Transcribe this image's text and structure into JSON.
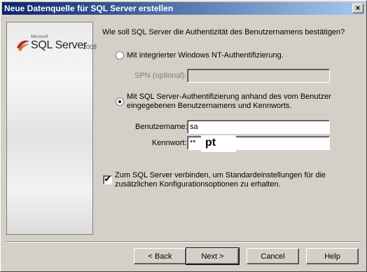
{
  "window": {
    "title": "Neue Datenquelle für SQL Server erstellen",
    "close_glyph": "×"
  },
  "sidebar": {
    "logo": {
      "microsoft": "Microsoft",
      "product": "SQL Server",
      "version": "2008"
    }
  },
  "auth": {
    "question": "Wie soll SQL Server die Authentizität des Benutzernamens bestätigen?",
    "option_windows": {
      "label": "Mit integrierter Windows NT-Authentifizierung.",
      "selected": false
    },
    "spn": {
      "label": "SPN (optional):",
      "value": ""
    },
    "option_sql": {
      "label_line1": "Mit SQL Server-Authentifizierung anhand des vom Benutzer",
      "label_line2": "eingegebenen Benutzernamens und Kennworts.",
      "selected": true
    },
    "username": {
      "label": "Benutzername:",
      "value": "sa"
    },
    "password": {
      "label": "Kennwort:",
      "value": "**"
    },
    "overlay_text": "pt"
  },
  "connect": {
    "checked": true,
    "check_glyph": "✔",
    "label_line1": "Zum SQL Server verbinden, um Standardeinstellungen für die",
    "label_line2": "zusätzlichen Konfigurationsoptionen zu erhalten."
  },
  "buttons": {
    "back": "< Back",
    "next": "Next >",
    "cancel": "Cancel",
    "help": "Help"
  }
}
